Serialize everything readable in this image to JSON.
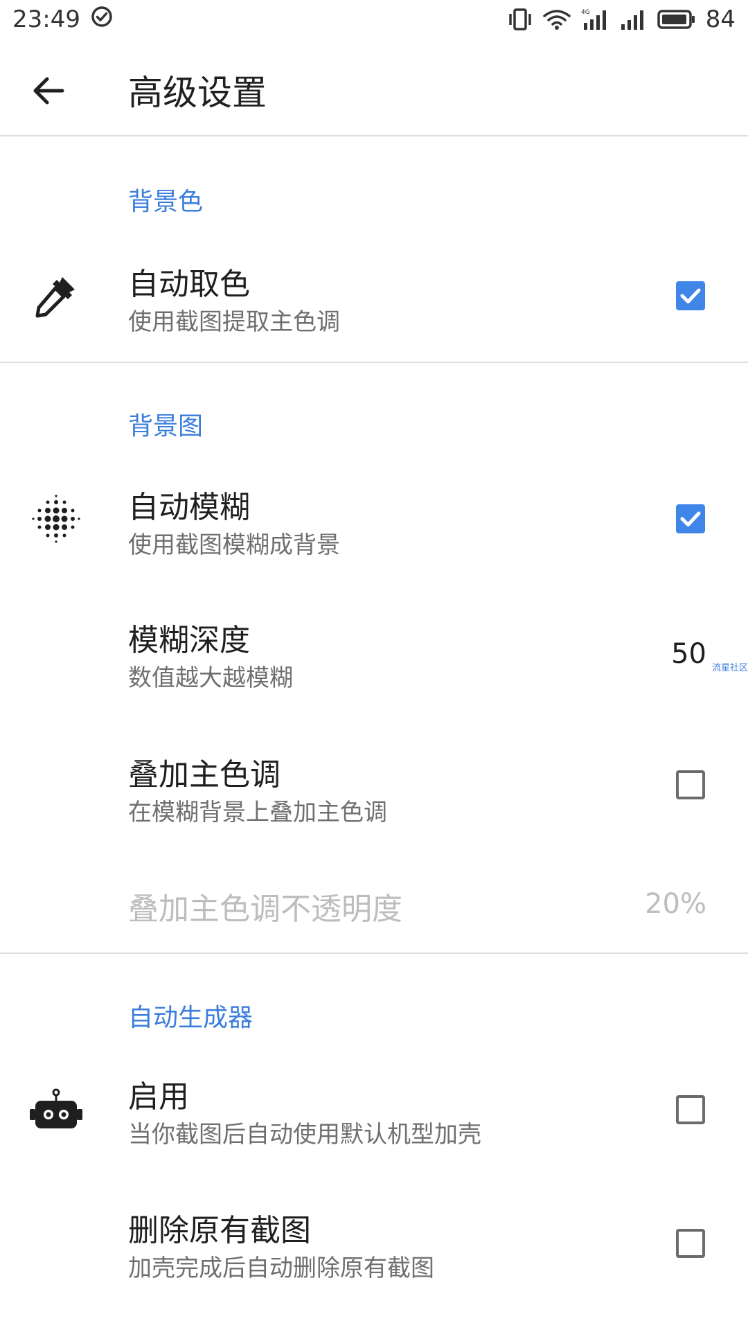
{
  "status_bar": {
    "time": "23:49",
    "battery": "84"
  },
  "app_bar": {
    "title": "高级设置"
  },
  "sections": {
    "background_color": {
      "header": "背景色",
      "auto_pick": {
        "title": "自动取色",
        "summary": "使用截图提取主色调",
        "checked": true
      }
    },
    "background_image": {
      "header": "背景图",
      "auto_blur": {
        "title": "自动模糊",
        "summary": "使用截图模糊成背景",
        "checked": true
      },
      "blur_depth": {
        "title": "模糊深度",
        "summary": "数值越大越模糊",
        "value": "50"
      },
      "overlay_tone": {
        "title": "叠加主色调",
        "summary": "在模糊背景上叠加主色调",
        "checked": false
      },
      "overlay_opacity": {
        "title": "叠加主色调不透明度",
        "value": "20%"
      }
    },
    "auto_generator": {
      "header": "自动生成器",
      "enable": {
        "title": "启用",
        "summary": "当你截图后自动使用默认机型加壳",
        "checked": false
      },
      "delete_original": {
        "title": "删除原有截图",
        "summary": "加壳完成后自动删除原有截图",
        "checked": false
      }
    }
  },
  "watermark": "流星社区",
  "colors": {
    "accent": "#3f86e8",
    "section_header": "#3b7ddd",
    "disabled_text": "#bdbdbd"
  }
}
